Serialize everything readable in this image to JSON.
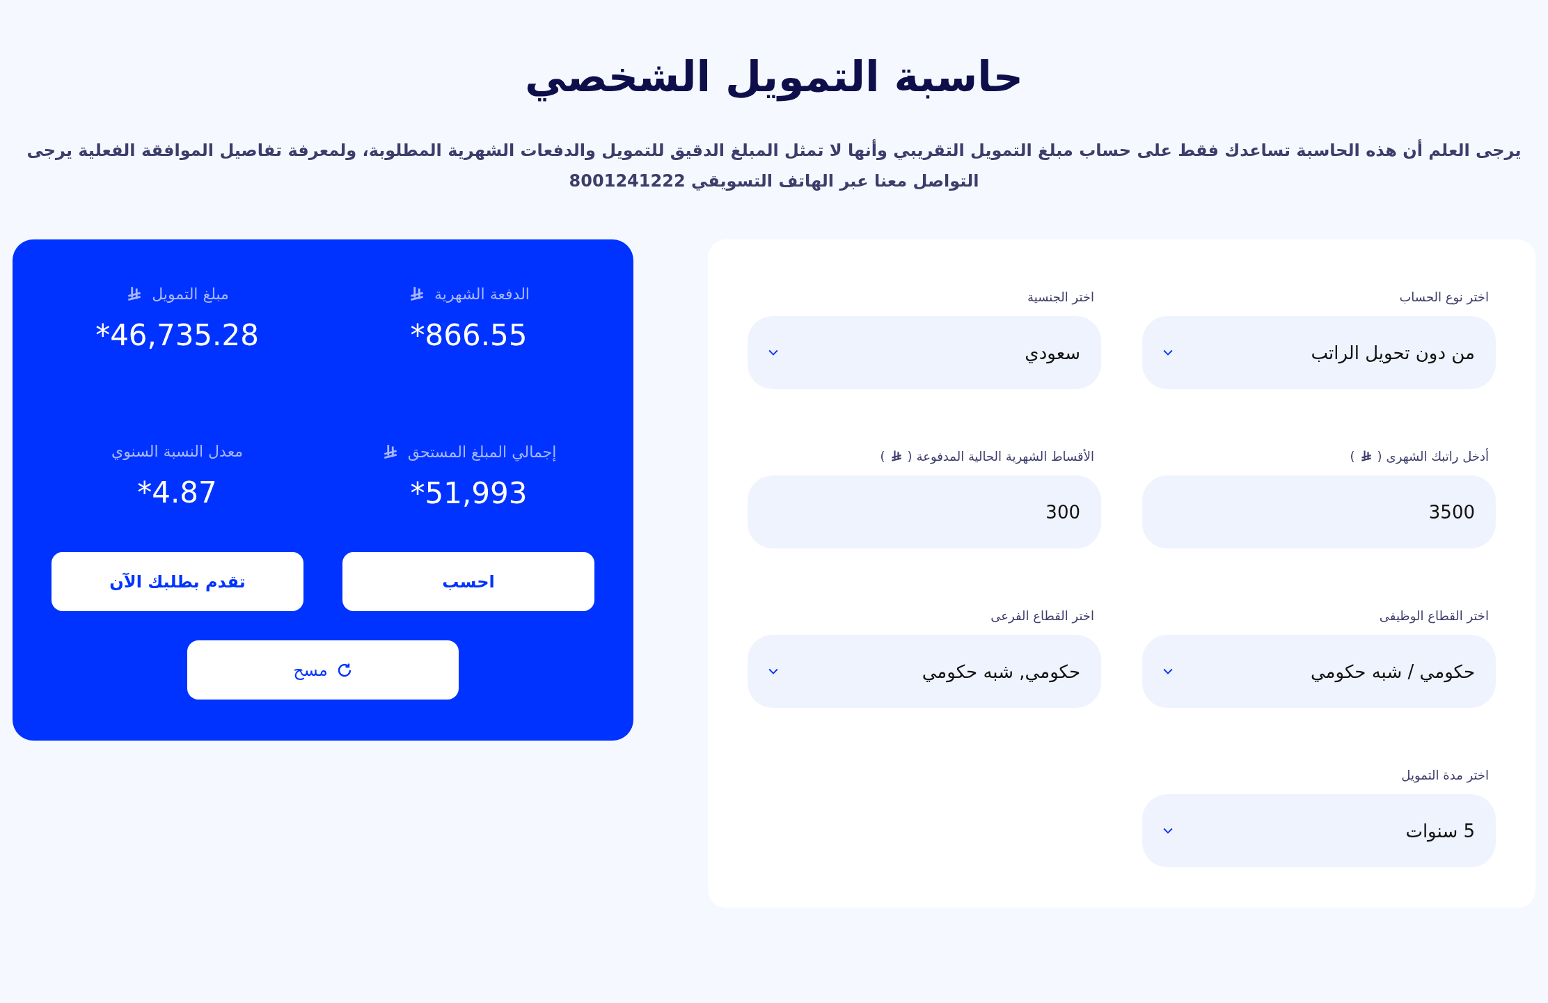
{
  "title": "حاسبة التمويل الشخصي",
  "notice": "يرجى العلم أن هذه الحاسبة تساعدك فقط على حساب مبلغ التمويل التقريبي وأنها لا تمثل المبلغ الدقيق للتمويل والدفعات الشهرية المطلوبة، ولمعرفة تفاصيل الموافقة الفعلية يرجى التواصل معنا عبر الهاتف التسويقي 8001241222",
  "form": {
    "fields": [
      {
        "kind": "select",
        "label": "اختر نوع الحساب",
        "value": "من دون تحويل الراتب"
      },
      {
        "kind": "select",
        "label": "اختر الجنسية",
        "value": "سعودي"
      },
      {
        "kind": "input",
        "label": "أدخل راتبك الشهرى",
        "unit_open": "(",
        "unit_close": ")",
        "value": "3500"
      },
      {
        "kind": "input",
        "label": "الأقساط الشهرية الحالية المدفوعة",
        "unit_open": "(",
        "unit_close": ")",
        "value": "300"
      },
      {
        "kind": "select",
        "label": "اختر القطاع الوظيفى",
        "value": "حكومي / شبه حكومي"
      },
      {
        "kind": "select",
        "label": "اختر القطاع الفرعى",
        "value": "حكومي, شبه حكومي"
      },
      {
        "kind": "select",
        "label": "اختر مدة التمويل",
        "value": "5 سنوات"
      }
    ]
  },
  "results": {
    "stats": [
      {
        "label": "الدفعة الشهرية",
        "currency": true,
        "value": "*866.55"
      },
      {
        "label": "مبلغ التمويل",
        "currency": true,
        "value": "*46,735.28"
      },
      {
        "label": "إجمالي المبلغ المستحق",
        "currency": true,
        "value": "*51,993"
      },
      {
        "label": "معدل النسبة السنوي",
        "currency": false,
        "value": "*4.87"
      }
    ],
    "buttons": [
      {
        "label": "احسب"
      },
      {
        "label": "تقدم بطلبك الآن"
      }
    ],
    "clear_button": {
      "label": "مسح"
    }
  }
}
